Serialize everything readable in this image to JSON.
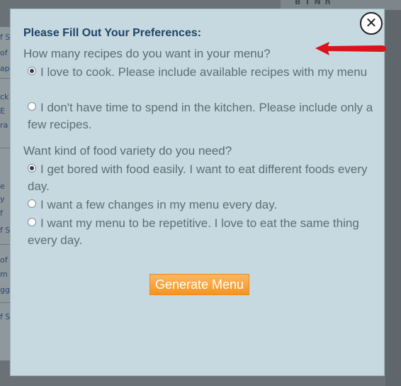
{
  "background": {
    "left_links": [
      "f S",
      "of",
      "ap",
      "ck",
      "E",
      "ra",
      "e",
      "y",
      "f",
      "f S",
      "of",
      "m",
      "gg",
      "f S"
    ],
    "top_right_text": "B    T   N   h"
  },
  "modal": {
    "title": "Please Fill Out Your Preferences:",
    "close_symbol": "✕",
    "question1": {
      "label": "How many recipes do you want in your menu?",
      "options": [
        {
          "label": "I love to cook. Please include available recipes with my menu",
          "selected": true
        },
        {
          "label": "I don't have time to spend in the kitchen. Please include only a few recipes.",
          "selected": false
        }
      ]
    },
    "question2": {
      "label": "Want kind of food variety do you need?",
      "options": [
        {
          "label": "I get bored with food easily. I want to eat different foods every day.",
          "selected": true
        },
        {
          "label": "I want a few changes in my menu every day.",
          "selected": false
        },
        {
          "label": "I want my menu to be repetitive. I love to eat the same thing every day.",
          "selected": false
        }
      ]
    },
    "generate_button": "Generate Menu"
  },
  "colors": {
    "modal_bg": "#c7d9e0",
    "title": "#1f4466",
    "button": "#f7941d",
    "arrow": "#d9141b"
  }
}
